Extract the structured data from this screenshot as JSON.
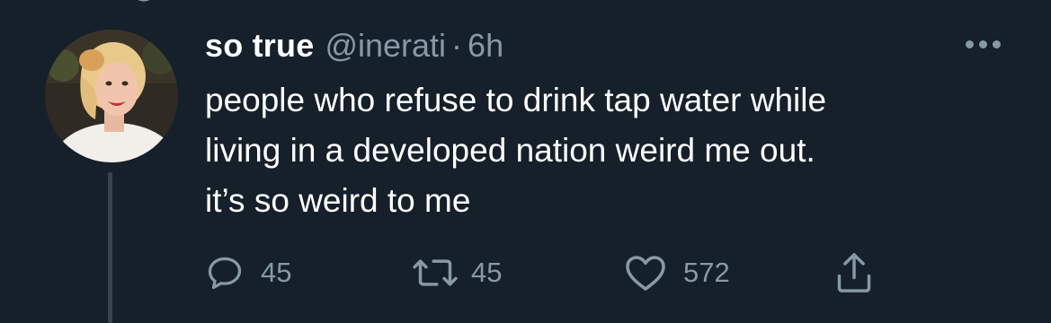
{
  "tweet": {
    "display_name": "so true",
    "handle": "@inerati",
    "separator": "·",
    "time": "6h",
    "text_lines": [
      "people who refuse to drink tap water while",
      "living in a developed nation weird me out.",
      "it’s so weird to me"
    ]
  },
  "actions": {
    "reply_count": "45",
    "retweet_count": "45",
    "like_count": "572"
  },
  "icons": {
    "reply": "reply-icon",
    "retweet": "retweet-icon",
    "like": "heart-icon",
    "share": "share-icon",
    "more": "more-icon"
  },
  "colors": {
    "background": "#15202b",
    "text_primary": "#ffffff",
    "text_secondary": "#8899a6",
    "thread_line": "#38444d"
  }
}
